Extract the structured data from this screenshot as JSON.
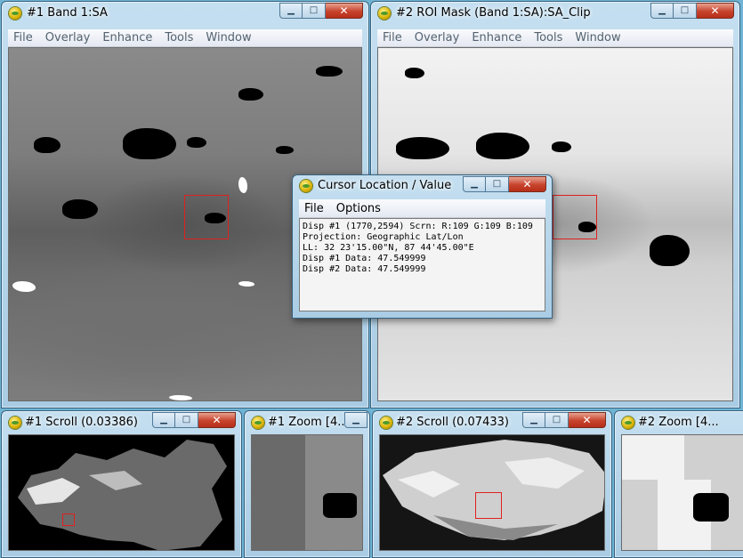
{
  "windows": {
    "band": {
      "title": "#1 Band 1:SA",
      "menu": [
        "File",
        "Overlay",
        "Enhance",
        "Tools",
        "Window"
      ]
    },
    "roi": {
      "title": "#2 ROI Mask (Band 1:SA):SA_Clip",
      "menu": [
        "File",
        "Overlay",
        "Enhance",
        "Tools",
        "Window"
      ]
    },
    "scroll1": {
      "title": "#1 Scroll (0.03386)"
    },
    "zoom1": {
      "title": "#1 Zoom [4..."
    },
    "scroll2": {
      "title": "#2 Scroll (0.07433)"
    },
    "zoom2": {
      "title": "#2 Zoom [4..."
    }
  },
  "titlebar_buttons": {
    "minimize": "▁",
    "maximize": "□",
    "close": "✕"
  },
  "cursor_dialog": {
    "title": "Cursor Location / Value",
    "menu": [
      "File",
      "Options"
    ],
    "lines": [
      "Disp #1 (1770,2594) Scrn: R:109 G:109 B:109",
      "Projection: Geographic Lat/Lon",
      "LL: 32 23'15.00\"N, 87 44'45.00\"E",
      "Disp #1 Data: 47.549999",
      "Disp #2 Data: 47.549999"
    ]
  },
  "colors": {
    "titlebar": "#a9cce4",
    "desktop": "#6fb4d4",
    "roi_box": "#e02020"
  }
}
